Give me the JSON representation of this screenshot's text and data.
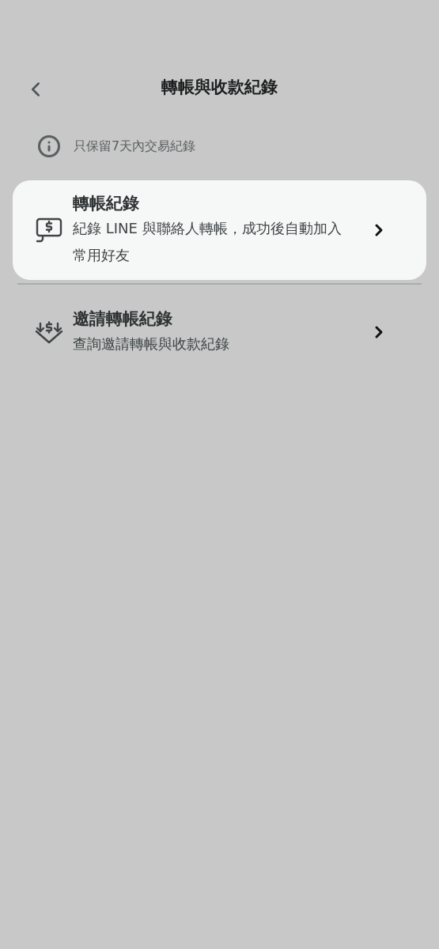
{
  "header": {
    "title": "轉帳與收款紀錄"
  },
  "notice": {
    "text": "只保留7天內交易紀錄"
  },
  "items": [
    {
      "kind": "chat-dollar",
      "title": "轉帳紀錄",
      "description": "紀錄 LINE 與聯絡人轉帳，成功後自動加入常用好友",
      "highlighted": true
    },
    {
      "kind": "down-dollar",
      "title": "邀請轉帳紀錄",
      "description": "查詢邀請轉帳與收款紀錄",
      "highlighted": false
    }
  ]
}
